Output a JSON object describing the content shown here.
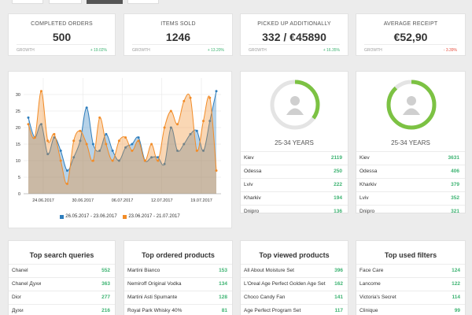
{
  "colors": {
    "blue": "#2f7ebd",
    "orange": "#f28c28",
    "green": "#3cb371",
    "red": "#e74c3c",
    "donut_fill": "#7cc243"
  },
  "kpis": [
    {
      "title": "COMPLETED ORDERS",
      "value": "500",
      "growth_label": "GROWTH",
      "growth": "+ 19.02%",
      "trend": "up"
    },
    {
      "title": "ITEMS SOLD",
      "value": "1246",
      "growth_label": "GROWTH",
      "growth": "+ 13.20%",
      "trend": "up"
    },
    {
      "title": "PICKED UP ADDITIONALLY",
      "value": "332 / €45890",
      "growth_label": "GROWTH",
      "growth": "+ 16.35%",
      "trend": "up"
    },
    {
      "title": "AVERAGE RECEIPT",
      "value": "€52,90",
      "growth_label": "GROWTH",
      "growth": "- 3.39%",
      "trend": "down"
    }
  ],
  "chart_data": {
    "type": "area",
    "x_ticks": [
      "24.06.2017",
      "30.06.2017",
      "06.07.2017",
      "12.07.2017",
      "19.07.2017"
    ],
    "ylim": [
      0,
      35
    ],
    "y_ticks": [
      0,
      5,
      10,
      15,
      20,
      25,
      30
    ],
    "grid": true,
    "legend_position": "bottom",
    "series": [
      {
        "name": "26.05.2017 - 23.06.2017",
        "color": "#2f7ebd",
        "values": [
          23,
          17,
          21,
          12,
          17,
          13,
          7,
          11,
          16,
          26,
          15,
          13,
          18,
          13,
          10,
          14,
          15,
          17,
          10,
          11,
          11,
          9,
          20,
          13,
          15,
          18,
          19,
          13,
          22,
          31
        ]
      },
      {
        "name": "23.06.2017 - 21.07.2017",
        "color": "#f28c28",
        "values": [
          21,
          17,
          31,
          16,
          18,
          10,
          3,
          16,
          19,
          15,
          10,
          23,
          15,
          10,
          16,
          17,
          13,
          16,
          10,
          15,
          10,
          20,
          25,
          21,
          28,
          29,
          13,
          22,
          29,
          7
        ]
      }
    ]
  },
  "demographics": [
    {
      "age_label": "25-34 YEARS",
      "percent": 35,
      "cities": [
        {
          "name": "Kiev",
          "value": "2119"
        },
        {
          "name": "Odessa",
          "value": "250"
        },
        {
          "name": "Lviv",
          "value": "222"
        },
        {
          "name": "Kharkiv",
          "value": "194"
        },
        {
          "name": "Dnipro",
          "value": "136"
        }
      ]
    },
    {
      "age_label": "25-34 YEARS",
      "percent": 88,
      "cities": [
        {
          "name": "Kiev",
          "value": "3631"
        },
        {
          "name": "Odessa",
          "value": "406"
        },
        {
          "name": "Kharkiv",
          "value": "379"
        },
        {
          "name": "Lviv",
          "value": "352"
        },
        {
          "name": "Dnipro",
          "value": "321"
        }
      ]
    }
  ],
  "top_lists": [
    {
      "title": "Top search queries",
      "rows": [
        {
          "name": "Chanel",
          "value": "552"
        },
        {
          "name": "Chanel Духи",
          "value": "363"
        },
        {
          "name": "Dior",
          "value": "277"
        },
        {
          "name": "Духи",
          "value": "216"
        }
      ]
    },
    {
      "title": "Top ordered products",
      "rows": [
        {
          "name": "Martini Bianco",
          "value": "153"
        },
        {
          "name": "Nemiroff Original Vodka",
          "value": "134"
        },
        {
          "name": "Martini Asti Spumante",
          "value": "128"
        },
        {
          "name": "Royal Park Whisky 40%",
          "value": "81"
        }
      ]
    },
    {
      "title": "Top viewed products",
      "rows": [
        {
          "name": "All About Moisture Set",
          "value": "396"
        },
        {
          "name": "L'Oreal Age Perfect Golden Age Set",
          "value": "162"
        },
        {
          "name": "Choco Candy Fan",
          "value": "141"
        },
        {
          "name": "Age Perfect Program Set",
          "value": "117"
        }
      ]
    },
    {
      "title": "Top used filters",
      "rows": [
        {
          "name": "Face Care",
          "value": "124"
        },
        {
          "name": "Lancome",
          "value": "122"
        },
        {
          "name": "Victoria's Secret",
          "value": "114"
        },
        {
          "name": "Clinique",
          "value": "99"
        }
      ]
    }
  ]
}
